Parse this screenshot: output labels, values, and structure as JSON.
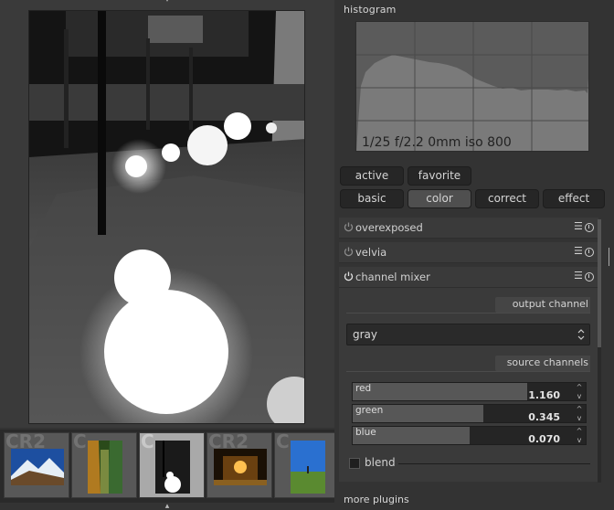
{
  "histogram": {
    "title": "histogram",
    "exposure_info": "1/25 f/2.2 0mm iso 800"
  },
  "filters": {
    "active": "active",
    "favorite": "favorite"
  },
  "groups": [
    {
      "label": "basic",
      "selected": false
    },
    {
      "label": "color",
      "selected": true
    },
    {
      "label": "correct",
      "selected": false
    },
    {
      "label": "effect",
      "selected": false
    }
  ],
  "plugins": {
    "overexposed": "overexposed",
    "velvia": "velvia",
    "channel_mixer": "channel mixer"
  },
  "channel_mixer": {
    "output_channel_label": "output channel",
    "output_channel_value": "gray",
    "source_channels_label": "source channels",
    "sliders": [
      {
        "name": "red",
        "value": "1.160",
        "fill": 0.75
      },
      {
        "name": "green",
        "value": "0.345",
        "fill": 0.56
      },
      {
        "name": "blue",
        "value": "0.070",
        "fill": 0.5
      }
    ],
    "blend_label": "blend"
  },
  "filmstrip": {
    "items": [
      {
        "ext": "CR2",
        "selected": false
      },
      {
        "ext": "C",
        "selected": false
      },
      {
        "ext": "C",
        "selected": true
      },
      {
        "ext": "CR2",
        "selected": false
      },
      {
        "ext": "C",
        "selected": false
      }
    ]
  },
  "footer": {
    "more_plugins": "more plugins"
  },
  "colors": {
    "panel_bg": "#333333",
    "button_bg": "#262626",
    "button_selected": "#4f4f4f"
  }
}
